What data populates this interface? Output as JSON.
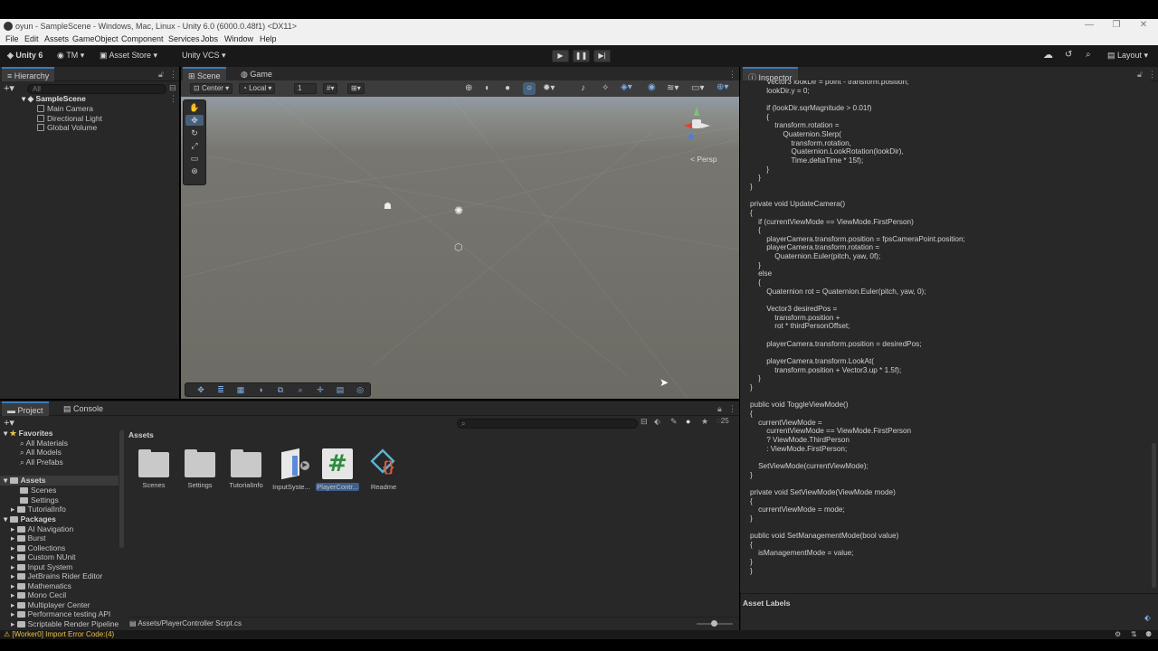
{
  "window": {
    "title": "oyun - SampleScene - Windows, Mac, Linux - Unity 6.0 (6000.0.48f1) <DX11>",
    "controls": [
      "—",
      "❐",
      "✕"
    ]
  },
  "menu": [
    "File",
    "Edit",
    "Assets",
    "GameObject",
    "Component",
    "Services",
    "Jobs",
    "Window",
    "Help"
  ],
  "toolbar": {
    "unity_label": "Unity 6",
    "account_label": "TM",
    "asset_store_label": "Asset Store",
    "vcs_label": "Unity VCS",
    "layout_label": "Layout"
  },
  "hierarchy": {
    "tab": "Hierarchy",
    "search_placeholder": "All",
    "scene": "SampleScene",
    "objects": [
      "Main Camera",
      "Directional Light",
      "Global Volume"
    ]
  },
  "scene": {
    "tabs": [
      "Scene",
      "Game"
    ],
    "pivot": "Center",
    "space": "Local",
    "grid_snap": "1",
    "persp_label": "< Persp"
  },
  "inspector": {
    "tab": "Inspector",
    "code": "        Vector3 lookDir = point - transform.position;\n        lookDir.y = 0;\n\n        if (lookDir.sqrMagnitude > 0.01f)\n        {\n            transform.rotation =\n                Quaternion.Slerp(\n                    transform.rotation,\n                    Quaternion.LookRotation(lookDir),\n                    Time.deltaTime * 15f);\n        }\n    }\n}\n\nprivate void UpdateCamera()\n{\n    if (currentViewMode == ViewMode.FirstPerson)\n    {\n        playerCamera.transform.position = fpsCameraPoint.position;\n        playerCamera.transform.rotation =\n            Quaternion.Euler(pitch, yaw, 0f);\n    }\n    else\n    {\n        Quaternion rot = Quaternion.Euler(pitch, yaw, 0);\n\n        Vector3 desiredPos =\n            transform.position +\n            rot * thirdPersonOffset;\n\n        playerCamera.transform.position = desiredPos;\n\n        playerCamera.transform.LookAt(\n            transform.position + Vector3.up * 1.5f);\n    }\n}\n\npublic void ToggleViewMode()\n{\n    currentViewMode =\n        currentViewMode == ViewMode.FirstPerson\n        ? ViewMode.ThirdPerson\n        : ViewMode.FirstPerson;\n\n    SetViewMode(currentViewMode);\n}\n\nprivate void SetViewMode(ViewMode mode)\n{\n    currentViewMode = mode;\n}\n\npublic void SetManagementMode(bool value)\n{\n    isManagementMode = value;\n}\n}",
    "asset_labels": "Asset Labels"
  },
  "project": {
    "tabs": [
      "Project",
      "Console"
    ],
    "favorites_label": "Favorites",
    "favorites": [
      "All Materials",
      "All Models",
      "All Prefabs"
    ],
    "assets_label": "Assets",
    "assets_folders": [
      "Scenes",
      "Settings",
      "TutorialInfo"
    ],
    "packages_label": "Packages",
    "packages": [
      "AI Navigation",
      "Burst",
      "Collections",
      "Custom NUnit",
      "Input System",
      "JetBrains Rider Editor",
      "Mathematics",
      "Mono Cecil",
      "Multiplayer Center",
      "Performance testing API",
      "Scriptable Render Pipeline"
    ],
    "breadcrumb": "Assets",
    "items": [
      "Scenes",
      "Settings",
      "TutorialInfo",
      "InputSyste...",
      "PlayerContr...",
      "Readme"
    ],
    "selected_path": "Assets/PlayerController Scrpt.cs",
    "hidden_count": "25"
  },
  "status": {
    "message": "[Worker0] Import Error Code:(4)"
  },
  "colors": {
    "accent": "#3a79bb",
    "panel": "#282828",
    "toolbar": "#191919"
  }
}
